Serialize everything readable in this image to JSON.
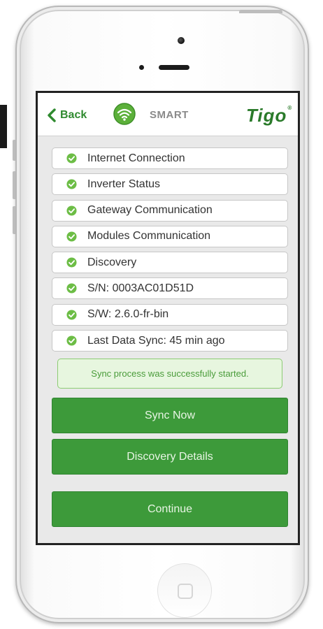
{
  "navbar": {
    "back_label": "Back",
    "mode_label": "SMART",
    "brand": "Tigo",
    "brand_mark": "®"
  },
  "status_items": [
    {
      "label": "Internet Connection",
      "status": "ok"
    },
    {
      "label": "Inverter Status",
      "status": "ok"
    },
    {
      "label": "Gateway Communication",
      "status": "ok"
    },
    {
      "label": "Modules Communication",
      "status": "ok"
    },
    {
      "label": "Discovery",
      "status": "ok"
    },
    {
      "label": "S/N: 0003AC01D51D",
      "status": "ok"
    },
    {
      "label": "S/W: 2.6.0-fr-bin",
      "status": "ok"
    },
    {
      "label": "Last Data Sync: 45 min ago",
      "status": "ok"
    }
  ],
  "notice": {
    "text": "Sync process was successfully started."
  },
  "buttons": {
    "sync_now": "Sync Now",
    "discovery_details": "Discovery Details",
    "continue": "Continue"
  },
  "icons": {
    "back": "chevron-left-icon",
    "status": "check-circle-icon",
    "connection": "wifi-icon"
  },
  "colors": {
    "brand_green": "#3d9a3a",
    "check_green": "#6cbd45",
    "notice_bg": "#e7f6df",
    "notice_text": "#4a9c3a"
  }
}
